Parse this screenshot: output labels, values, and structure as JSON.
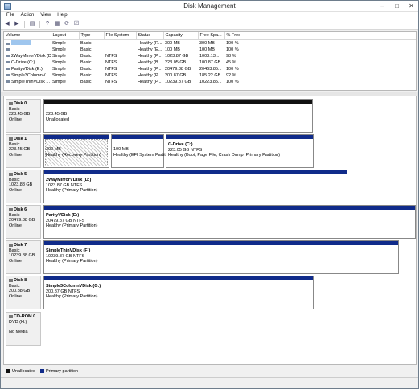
{
  "window": {
    "title": "Disk Management",
    "controls": [
      "–",
      "□",
      "✕"
    ]
  },
  "menu": [
    "File",
    "Action",
    "View",
    "Help"
  ],
  "toolbar": [
    "back-icon",
    "forward-icon",
    "list-icon",
    "help-icon",
    "properties-icon",
    "refresh-icon",
    "settings-icon"
  ],
  "volume_table": {
    "columns": [
      "Volume",
      "Layout",
      "Type",
      "File System",
      "Status",
      "Capacity",
      "Free Spa...",
      "% Free"
    ],
    "rows": [
      [
        "",
        "Simple",
        "Basic",
        "",
        "Healthy (R...",
        "300 MB",
        "300 MB",
        "100 %"
      ],
      [
        "",
        "Simple",
        "Basic",
        "",
        "Healthy (E...",
        "100 MB",
        "100 MB",
        "100 %"
      ],
      [
        "2WayMirrorVDisk (D:)",
        "Simple",
        "Basic",
        "NTFS",
        "Healthy (P...",
        "1023.87 GB",
        "1008.13 ...",
        "98 %"
      ],
      [
        "C-Drive (C:)",
        "Simple",
        "Basic",
        "NTFS",
        "Healthy (B...",
        "223.05 GB",
        "100.87 GB",
        "45 %"
      ],
      [
        "ParityVDisk (E:)",
        "Simple",
        "Basic",
        "NTFS",
        "Healthy (P...",
        "20479.88 GB",
        "20463.85...",
        "100 %"
      ],
      [
        "Simple3ColumnV...",
        "Simple",
        "Basic",
        "NTFS",
        "Healthy (P...",
        "200.87 GB",
        "185.22 GB",
        "92 %"
      ],
      [
        "SimpleThinVDisk ...",
        "Simple",
        "Basic",
        "NTFS",
        "Healthy (P...",
        "10239.87 GB",
        "10223.85...",
        "100 %"
      ]
    ]
  },
  "disks": [
    {
      "name": "Disk 0",
      "type": "Basic",
      "size": "223.45 GB",
      "status": "Online",
      "partitions": [
        {
          "bar": "black",
          "name": "",
          "line1": "223.45 GB",
          "line2": "Unallocated",
          "hatched": false
        }
      ]
    },
    {
      "name": "Disk 1",
      "type": "Basic",
      "size": "223.45 GB",
      "status": "Online",
      "partitions": [
        {
          "bar": "blue",
          "name": "",
          "line1": "300 MB",
          "line2": "Healthy (Recovery Partition)",
          "hatched": true
        },
        {
          "bar": "blue",
          "name": "",
          "line1": "100 MB",
          "line2": "Healthy (EFI System Partit",
          "hatched": false
        },
        {
          "bar": "blue",
          "name": "C-Drive (C:)",
          "line1": "223.05 GB NTFS",
          "line2": "Healthy (Boot, Page File, Crash Dump, Primary Partition)",
          "hatched": false
        }
      ]
    },
    {
      "name": "Disk 5",
      "type": "Basic",
      "size": "1023.88 GB",
      "status": "Online",
      "partitions": [
        {
          "bar": "blue",
          "name": "2WayMirrorVDisk (D:)",
          "line1": "1023.87 GB NTFS",
          "line2": "Healthy (Primary Partition)",
          "hatched": false
        }
      ]
    },
    {
      "name": "Disk 6",
      "type": "Basic",
      "size": "20479.88 GB",
      "status": "Online",
      "partitions": [
        {
          "bar": "blue",
          "name": "ParityVDisk (E:)",
          "line1": "20479.87 GB NTFS",
          "line2": "Healthy (Primary Partition)",
          "hatched": false
        }
      ]
    },
    {
      "name": "Disk 7",
      "type": "Basic",
      "size": "10239.88 GB",
      "status": "Online",
      "partitions": [
        {
          "bar": "blue",
          "name": "SimpleThinVDisk (F:)",
          "line1": "10239.87 GB NTFS",
          "line2": "Healthy (Primary Partition)",
          "hatched": false
        }
      ]
    },
    {
      "name": "Disk 8",
      "type": "Basic",
      "size": "200.88 GB",
      "status": "Online",
      "partitions": [
        {
          "bar": "blue",
          "name": "Simple3ColumnVDisk (G:)",
          "line1": "200.87 GB NTFS",
          "line2": "Healthy (Primary Partition)",
          "hatched": false
        }
      ]
    },
    {
      "name": "CD-ROM 0",
      "type": "DVD (H:)",
      "size": "",
      "status": "No Media",
      "partitions": []
    }
  ],
  "legend": [
    {
      "label": "Unallocated",
      "color": "#111111"
    },
    {
      "label": "Primary partition",
      "color": "#102b8a"
    }
  ]
}
